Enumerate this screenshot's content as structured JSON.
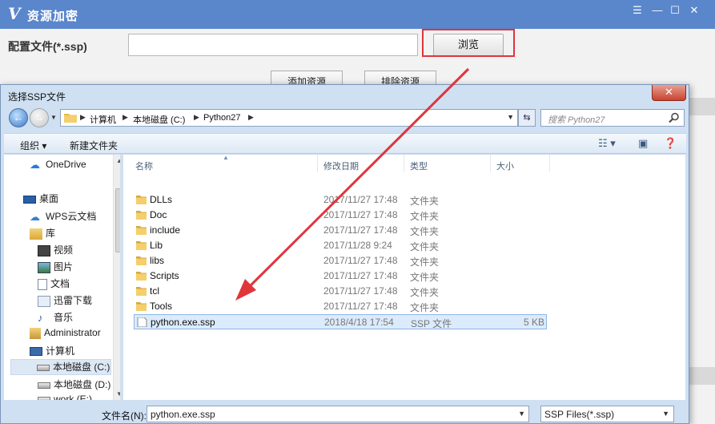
{
  "app": {
    "logo": "V",
    "title": "资源加密",
    "config_label": "配置文件(*.ssp)",
    "config_value": "",
    "browse_label": "浏览",
    "add_label": "添加资源",
    "remove_label": "排除资源"
  },
  "dialog": {
    "title": "选择SSP文件",
    "close": "✕",
    "address": [
      "计算机",
      "本地磁盘 (C:)",
      "Python27"
    ],
    "search_placeholder": "搜索 Python27",
    "organize": "组织 ▾",
    "new_folder": "新建文件夹",
    "columns": {
      "name": "名称",
      "date": "修改日期",
      "type": "类型",
      "size": "大小"
    },
    "nav": [
      {
        "label": "OneDrive"
      },
      {
        "label": "桌面"
      },
      {
        "label": "WPS云文档"
      },
      {
        "label": "库"
      },
      {
        "label": "视频"
      },
      {
        "label": "图片"
      },
      {
        "label": "文档"
      },
      {
        "label": "迅雷下载"
      },
      {
        "label": "音乐"
      },
      {
        "label": "Administrator"
      },
      {
        "label": "计算机"
      },
      {
        "label": "本地磁盘 (C:)"
      },
      {
        "label": "本地磁盘 (D:)"
      },
      {
        "label": "work (E:)"
      }
    ],
    "files": [
      {
        "name": "DLLs",
        "date": "2017/11/27 17:48",
        "type": "文件夹",
        "size": ""
      },
      {
        "name": "Doc",
        "date": "2017/11/27 17:48",
        "type": "文件夹",
        "size": ""
      },
      {
        "name": "include",
        "date": "2017/11/27 17:48",
        "type": "文件夹",
        "size": ""
      },
      {
        "name": "Lib",
        "date": "2017/11/28 9:24",
        "type": "文件夹",
        "size": ""
      },
      {
        "name": "libs",
        "date": "2017/11/27 17:48",
        "type": "文件夹",
        "size": ""
      },
      {
        "name": "Scripts",
        "date": "2017/11/27 17:48",
        "type": "文件夹",
        "size": ""
      },
      {
        "name": "tcl",
        "date": "2017/11/27 17:48",
        "type": "文件夹",
        "size": ""
      },
      {
        "name": "Tools",
        "date": "2017/11/27 17:48",
        "type": "文件夹",
        "size": ""
      },
      {
        "name": "python.exe.ssp",
        "date": "2018/4/18 17:54",
        "type": "SSP 文件",
        "size": "5 KB"
      }
    ],
    "filename_label": "文件名(N):",
    "filename_value": "python.exe.ssp",
    "filetype_value": "SSP Files(*.ssp)"
  },
  "colors": {
    "app_titlebar": "#5a86cc",
    "annotation_red": "#e0353a",
    "selection": "#dcebfb"
  }
}
